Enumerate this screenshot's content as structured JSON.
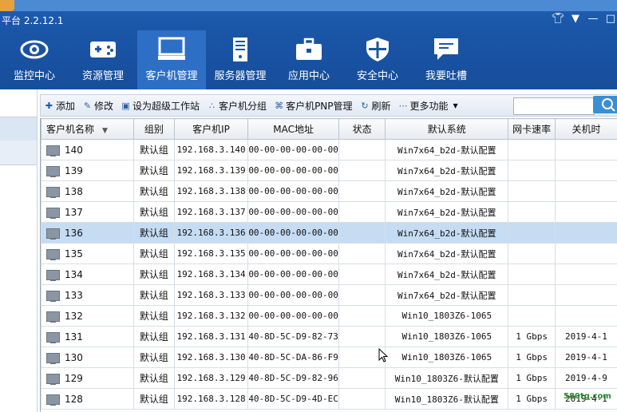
{
  "window": {
    "title": "平台 2.2.12.1",
    "controls": [
      "shirt-icon",
      "dropdown-icon",
      "minimize-icon",
      "maximize-icon"
    ]
  },
  "nav": {
    "items": [
      {
        "label": "监控中心",
        "icon": "eye-icon",
        "active": false
      },
      {
        "label": "资源管理",
        "icon": "gamepad-icon",
        "active": false
      },
      {
        "label": "客户机管理",
        "icon": "monitor-icon",
        "active": true
      },
      {
        "label": "服务器管理",
        "icon": "server-icon",
        "active": false
      },
      {
        "label": "应用中心",
        "icon": "toolbox-icon",
        "active": false
      },
      {
        "label": "安全中心",
        "icon": "shield-icon",
        "active": false
      },
      {
        "label": "我要吐槽",
        "icon": "chat-icon",
        "active": false
      }
    ]
  },
  "toolbar": {
    "add": "添加",
    "edit": "修改",
    "super": "设为超级工作站",
    "group": "客户机分组",
    "pnp": "客户机PNP管理",
    "refresh": "刷新",
    "more": "更多功能",
    "search_value": ""
  },
  "table": {
    "headers": [
      "客户机名称",
      "组别",
      "客户机IP",
      "MAC地址",
      "状态",
      "默认系统",
      "网卡速率",
      "关机时"
    ],
    "selected_row": 4,
    "rows": [
      {
        "name": "140",
        "group": "默认组",
        "ip": "192.168.3.140",
        "mac": "00-00-00-00-00-00",
        "status": "",
        "system": "Win7x64_b2d-默认配置",
        "speed": "",
        "shutdown": ""
      },
      {
        "name": "139",
        "group": "默认组",
        "ip": "192.168.3.139",
        "mac": "00-00-00-00-00-00",
        "status": "",
        "system": "Win7x64_b2d-默认配置",
        "speed": "",
        "shutdown": ""
      },
      {
        "name": "138",
        "group": "默认组",
        "ip": "192.168.3.138",
        "mac": "00-00-00-00-00-00",
        "status": "",
        "system": "Win7x64_b2d-默认配置",
        "speed": "",
        "shutdown": ""
      },
      {
        "name": "137",
        "group": "默认组",
        "ip": "192.168.3.137",
        "mac": "00-00-00-00-00-00",
        "status": "",
        "system": "Win7x64_b2d-默认配置",
        "speed": "",
        "shutdown": ""
      },
      {
        "name": "136",
        "group": "默认组",
        "ip": "192.168.3.136",
        "mac": "00-00-00-00-00-00",
        "status": "",
        "system": "Win7x64_b2d-默认配置",
        "speed": "",
        "shutdown": ""
      },
      {
        "name": "135",
        "group": "默认组",
        "ip": "192.168.3.135",
        "mac": "00-00-00-00-00-00",
        "status": "",
        "system": "Win7x64_b2d-默认配置",
        "speed": "",
        "shutdown": ""
      },
      {
        "name": "134",
        "group": "默认组",
        "ip": "192.168.3.134",
        "mac": "00-00-00-00-00-00",
        "status": "",
        "system": "Win7x64_b2d-默认配置",
        "speed": "",
        "shutdown": ""
      },
      {
        "name": "133",
        "group": "默认组",
        "ip": "192.168.3.133",
        "mac": "00-00-00-00-00-00",
        "status": "",
        "system": "Win7x64_b2d-默认配置",
        "speed": "",
        "shutdown": ""
      },
      {
        "name": "132",
        "group": "默认组",
        "ip": "192.168.3.132",
        "mac": "00-00-00-00-00-00",
        "status": "",
        "system": "Win10_1803Z6-1065",
        "speed": "",
        "shutdown": ""
      },
      {
        "name": "131",
        "group": "默认组",
        "ip": "192.168.3.131",
        "mac": "40-8D-5C-D9-82-73",
        "status": "",
        "system": "Win10_1803Z6-1065",
        "speed": "1 Gbps",
        "shutdown": "2019-4-1"
      },
      {
        "name": "130",
        "group": "默认组",
        "ip": "192.168.3.130",
        "mac": "40-8D-5C-DA-86-F9",
        "status": "",
        "system": "Win10_1803Z6-1065",
        "speed": "1 Gbps",
        "shutdown": "2019-4-1"
      },
      {
        "name": "129",
        "group": "默认组",
        "ip": "192.168.3.129",
        "mac": "40-8D-5C-D9-82-96",
        "status": "",
        "system": "Win10_1803Z6-默认配置",
        "speed": "1 Gbps",
        "shutdown": "2019-4-9"
      },
      {
        "name": "128",
        "group": "默认组",
        "ip": "192.168.3.128",
        "mac": "40-8D-5C-D9-4D-EC",
        "status": "",
        "system": "Win10_1803Z6-默认配置",
        "speed": "1 Gbps",
        "shutdown": "2019-4-1"
      }
    ]
  },
  "watermark": "580tg.com"
}
